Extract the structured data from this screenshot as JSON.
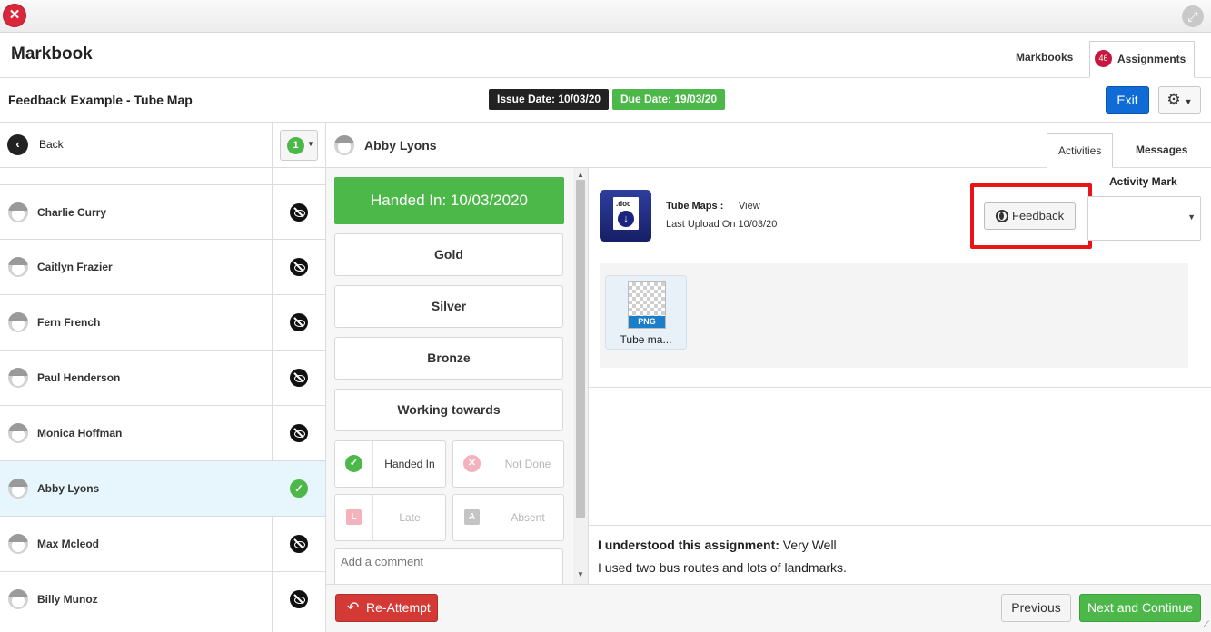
{
  "window": {
    "close_icon": "close-icon",
    "expand_icon": "expand-icon"
  },
  "header": {
    "app_title": "Markbook",
    "tabs": [
      {
        "label": "Markbooks"
      },
      {
        "label": "Assignments",
        "badge": "46"
      }
    ]
  },
  "assignment": {
    "title": "Feedback Example - Tube Map",
    "issue_date": "Issue Date: 10/03/20",
    "due_date": "Due Date: 19/03/20",
    "exit_label": "Exit"
  },
  "sidebar": {
    "back_label": "Back",
    "count": "1",
    "students": [
      {
        "name": "Charlie Curry",
        "status": "hidden"
      },
      {
        "name": "Caitlyn Frazier",
        "status": "hidden"
      },
      {
        "name": "Fern French",
        "status": "hidden"
      },
      {
        "name": "Paul Henderson",
        "status": "hidden"
      },
      {
        "name": "Monica Hoffman",
        "status": "hidden"
      },
      {
        "name": "Abby Lyons",
        "status": "done",
        "selected": true
      },
      {
        "name": "Max Mcleod",
        "status": "hidden"
      },
      {
        "name": "Billy Munoz",
        "status": "hidden"
      }
    ]
  },
  "student_header": {
    "name": "Abby Lyons",
    "tabs": [
      {
        "label": "Activities",
        "active": true
      },
      {
        "label": "Messages"
      }
    ]
  },
  "marking": {
    "handed_in_banner": "Handed In: 10/03/2020",
    "grades": [
      "Gold",
      "Silver",
      "Bronze",
      "Working towards"
    ],
    "statuses": [
      {
        "label": "Handed In",
        "icon": "check-icon",
        "glyph": "✓",
        "color": "#4cb849"
      },
      {
        "label": "Not Done",
        "icon": "x-icon",
        "glyph": "✕",
        "color": "#f2b3bf"
      },
      {
        "label": "Late",
        "icon": "late-icon",
        "glyph": "L",
        "color": "#f2b3bf"
      },
      {
        "label": "Absent",
        "icon": "absent-icon",
        "glyph": "A",
        "color": "#c4c4c4"
      }
    ],
    "comment_placeholder": "Add a comment"
  },
  "activity": {
    "doc_ext": ".doc",
    "name": "Tube Maps :",
    "view_label": "View",
    "last_upload": "Last Upload On 10/03/20",
    "feedback_label": "Feedback",
    "mark_label": "Activity Mark",
    "file": {
      "type": "PNG",
      "name": "Tube ma..."
    }
  },
  "response": {
    "question": "I understood this assignment:",
    "answer": "Very Well",
    "comment": "I used two bus routes and lots of landmarks."
  },
  "footer": {
    "reattempt_label": "Re-Attempt",
    "previous_label": "Previous",
    "next_label": "Next and Continue"
  },
  "colors": {
    "accent_green": "#4cb849",
    "exit_blue": "#0f6cd6",
    "reattempt_red": "#d33a36",
    "highlight_red": "#e8141a"
  }
}
